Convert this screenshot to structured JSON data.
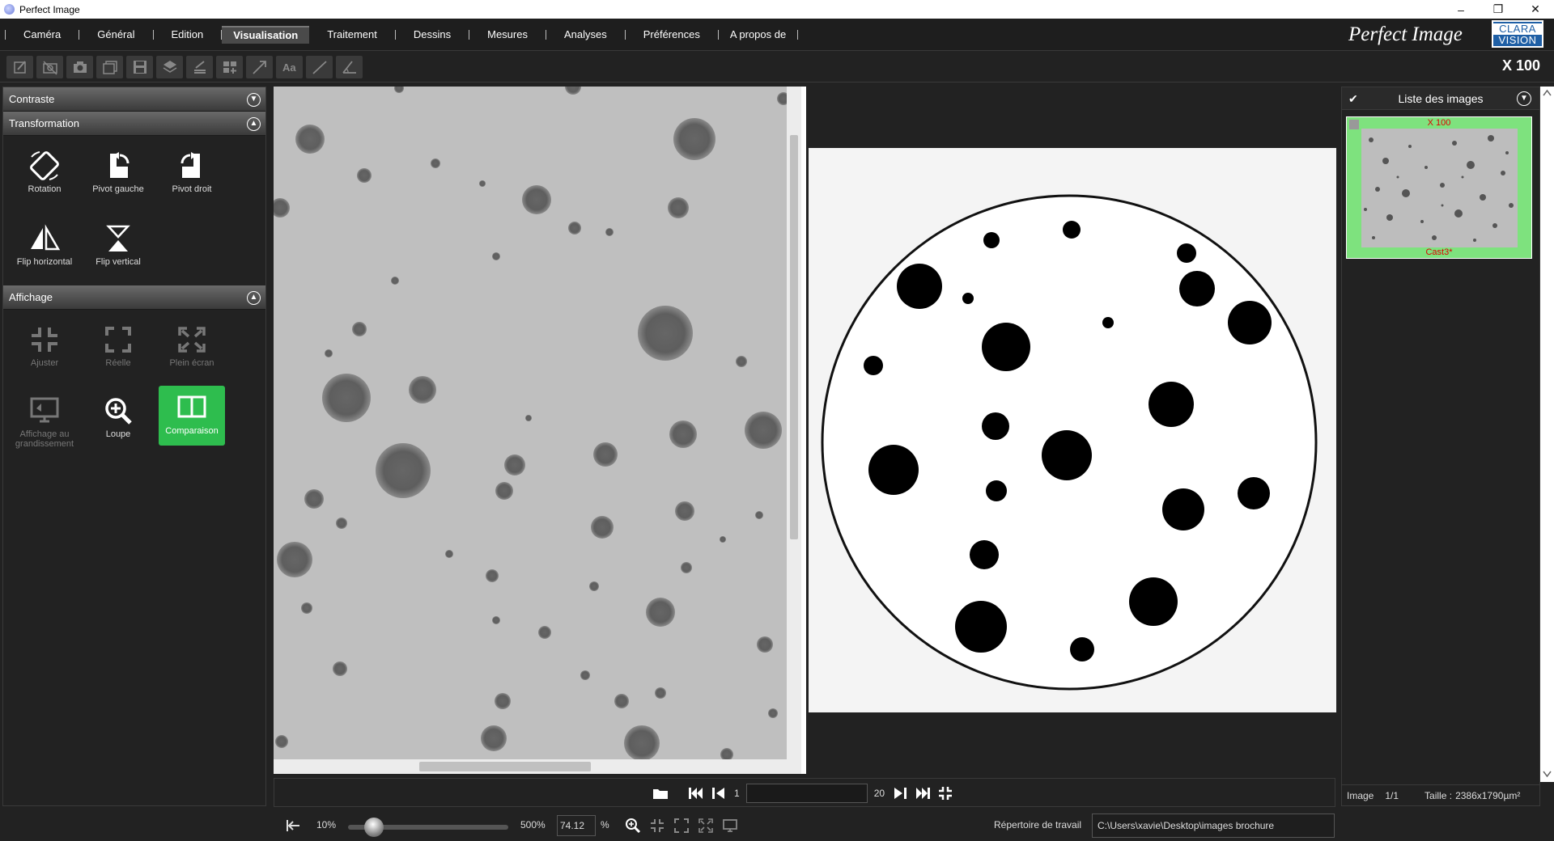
{
  "window": {
    "title": "Perfect Image"
  },
  "menu": {
    "items": [
      "Caméra",
      "Général",
      "Edition",
      "Visualisation",
      "Traitement",
      "Dessins",
      "Mesures",
      "Analyses",
      "Préférences",
      "A propos de"
    ],
    "active": "Visualisation"
  },
  "brand": {
    "name": "Perfect Image",
    "logo_line1": "CLARA",
    "logo_line2": "VISION"
  },
  "toolbar": {
    "zoom": "X 100",
    "icons": [
      "edit-icon",
      "no-camera-icon",
      "camera-icon",
      "gallery-icon",
      "save-icon",
      "layers-icon",
      "stack-icon",
      "grid-icon",
      "arrow-icon",
      "text-icon",
      "line-icon",
      "angle-icon"
    ]
  },
  "left": {
    "contrast": "Contraste",
    "transformation": {
      "title": "Transformation",
      "rotation": "Rotation",
      "pivot_left": "Pivot gauche",
      "pivot_right": "Pivot droit",
      "flip_h": "Flip horizontal",
      "flip_v": "Flip vertical"
    },
    "display": {
      "title": "Affichage",
      "fit": "Ajuster",
      "real": "Réelle",
      "fullscreen": "Plein écran",
      "mag_line1": "Affichage au",
      "mag_line2": "grandissement",
      "loupe": "Loupe",
      "comparison": "Comparaison"
    }
  },
  "images": {
    "title": "Liste des images",
    "thumb_top": "X 100",
    "thumb_bottom": "Cast3*",
    "footer_image": "Image",
    "footer_count": "1/1",
    "footer_size_label": "Taille :",
    "footer_size": "2386x1790µm²"
  },
  "nav": {
    "first": "1",
    "last": "20"
  },
  "bottom": {
    "min": "10%",
    "max": "500%",
    "zoom": "74.12",
    "pct": "%",
    "dir_label": "Répertoire de travail",
    "dir": "C:\\Users\\xavie\\Desktop\\images brochure"
  },
  "colors": {
    "accent_green": "#2ebd4e",
    "thumb_green": "#7ee27e",
    "logo_blue": "#1f5fa5"
  }
}
